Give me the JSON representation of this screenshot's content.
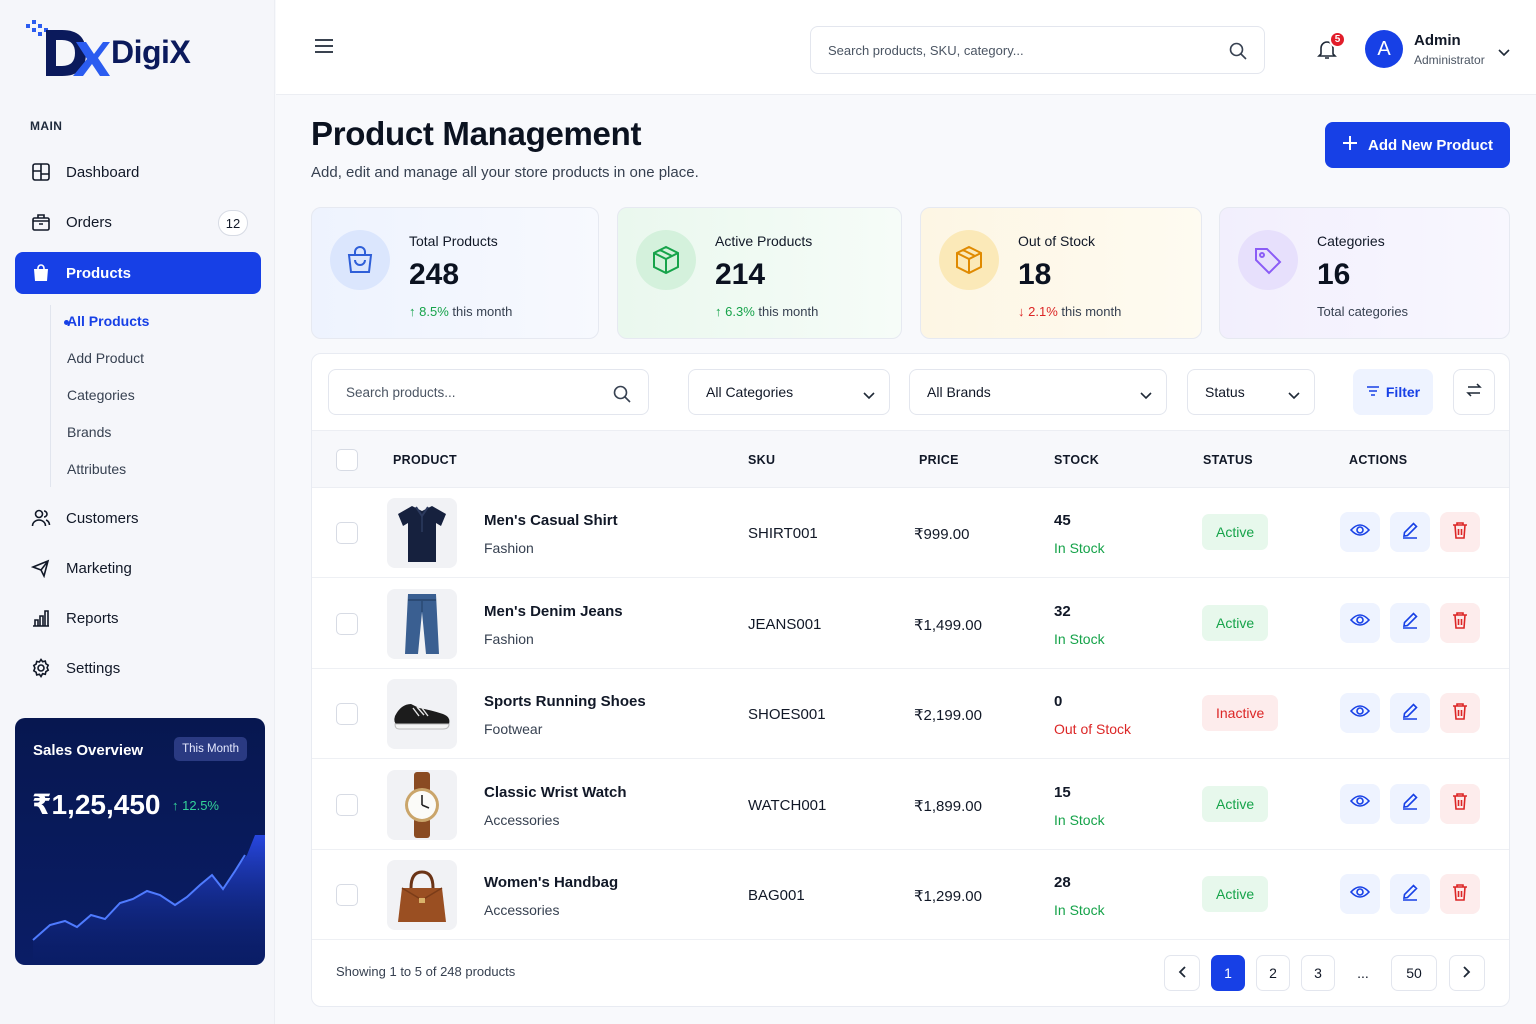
{
  "brand": {
    "name": "DigiX"
  },
  "sidebar": {
    "section_label": "MAIN",
    "items": [
      {
        "label": "Dashboard",
        "icon": "dashboard-icon"
      },
      {
        "label": "Orders",
        "icon": "orders-icon",
        "badge": "12"
      },
      {
        "label": "Products",
        "icon": "products-icon",
        "active": true
      },
      {
        "label": "Customers",
        "icon": "customers-icon"
      },
      {
        "label": "Marketing",
        "icon": "megaphone-icon"
      },
      {
        "label": "Reports",
        "icon": "reports-icon"
      },
      {
        "label": "Settings",
        "icon": "gear-icon"
      }
    ],
    "products_sub": [
      "All Products",
      "Add Product",
      "Categories",
      "Brands",
      "Attributes"
    ],
    "sales_overview": {
      "title": "Sales Overview",
      "period": "This Month",
      "value": "₹1,25,450",
      "delta": "12.5%"
    }
  },
  "topbar": {
    "search_placeholder": "Search products, SKU, category...",
    "notifications": "5",
    "user": {
      "initial": "A",
      "name": "Admin",
      "role": "Administrator"
    }
  },
  "page": {
    "title": "Product Management",
    "subtitle": "Add, edit and manage all your store products in one place.",
    "add_button": "Add New Product"
  },
  "stats": [
    {
      "label": "Total Products",
      "value": "248",
      "delta": "8.5%",
      "delta_suffix": "this month",
      "trend": "up",
      "accent": "#3b6fe0"
    },
    {
      "label": "Active Products",
      "value": "214",
      "delta": "6.3%",
      "delta_suffix": "this month",
      "trend": "up",
      "accent": "#16a34a"
    },
    {
      "label": "Out of Stock",
      "value": "18",
      "delta": "2.1%",
      "delta_suffix": "this month",
      "trend": "down",
      "accent": "#f59e0b"
    },
    {
      "label": "Categories",
      "value": "16",
      "foot": "Total categories",
      "accent": "#8b5cf6"
    }
  ],
  "filters": {
    "search_placeholder": "Search products...",
    "category": "All Categories",
    "brand": "All Brands",
    "status": "Status",
    "filter_button": "Filter"
  },
  "table": {
    "columns": [
      "PRODUCT",
      "SKU",
      "PRICE",
      "STOCK",
      "STATUS",
      "ACTIONS"
    ],
    "rows": [
      {
        "name": "Men's Casual Shirt",
        "category": "Fashion",
        "sku": "SHIRT001",
        "price": "₹999.00",
        "stock": "45",
        "stock_status": "In Stock",
        "status": "Active",
        "image": "shirt"
      },
      {
        "name": "Men's Denim Jeans",
        "category": "Fashion",
        "sku": "JEANS001",
        "price": "₹1,499.00",
        "stock": "32",
        "stock_status": "In Stock",
        "status": "Active",
        "image": "jeans"
      },
      {
        "name": "Sports Running Shoes",
        "category": "Footwear",
        "sku": "SHOES001",
        "price": "₹2,199.00",
        "stock": "0",
        "stock_status": "Out of Stock",
        "status": "Inactive",
        "image": "shoes"
      },
      {
        "name": "Classic Wrist Watch",
        "category": "Accessories",
        "sku": "WATCH001",
        "price": "₹1,899.00",
        "stock": "15",
        "stock_status": "In Stock",
        "status": "Active",
        "image": "watch"
      },
      {
        "name": "Women's Handbag",
        "category": "Accessories",
        "sku": "BAG001",
        "price": "₹1,299.00",
        "stock": "28",
        "stock_status": "In Stock",
        "status": "Active",
        "image": "bag"
      }
    ]
  },
  "pagination": {
    "summary": "Showing 1 to 5 of 248 products",
    "pages": [
      "1",
      "2",
      "3",
      "...",
      "50"
    ],
    "current": "1"
  }
}
